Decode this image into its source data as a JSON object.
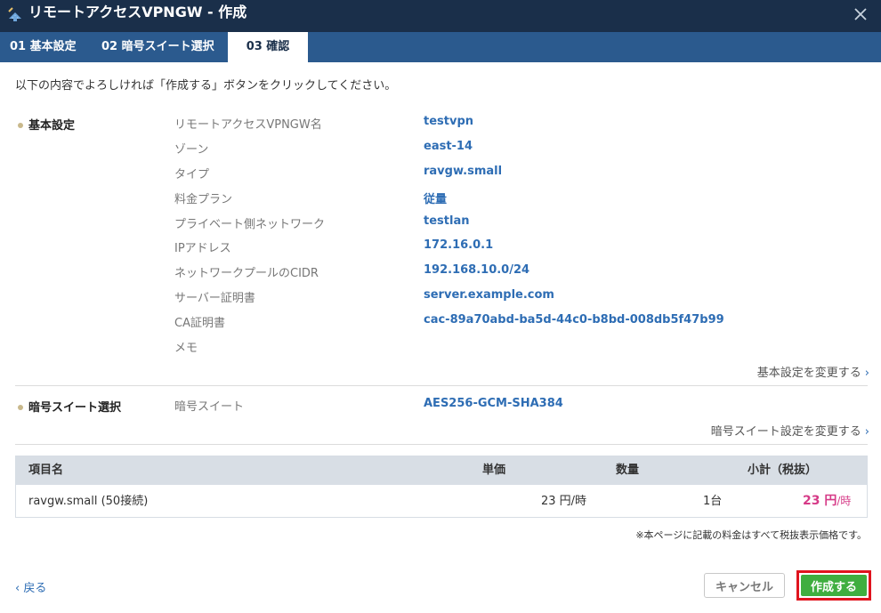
{
  "window": {
    "title": "リモートアクセスVPNGW - 作成",
    "close_symbol": "✕"
  },
  "tabs": [
    {
      "label": "01 基本設定",
      "active": false
    },
    {
      "label": "02 暗号スイート選択",
      "active": false
    },
    {
      "label": "03 確認",
      "active": true
    }
  ],
  "intro": "以下の内容でよろしければ「作成する」ボタンをクリックしてください。",
  "basic": {
    "section_label": "基本設定",
    "rows": [
      {
        "label": "リモートアクセスVPNGW名",
        "value": "testvpn"
      },
      {
        "label": "ゾーン",
        "value": "east-14"
      },
      {
        "label": "タイプ",
        "value": "ravgw.small"
      },
      {
        "label": "料金プラン",
        "value": "従量"
      },
      {
        "label": "プライベート側ネットワーク",
        "value": "testlan"
      },
      {
        "label": "IPアドレス",
        "value": "172.16.0.1"
      },
      {
        "label": "ネットワークプールのCIDR",
        "value": "192.168.10.0/24"
      },
      {
        "label": "サーバー証明書",
        "value": "server.example.com"
      },
      {
        "label": "CA証明書",
        "value": "cac-89a70abd-ba5d-44c0-b8bd-008db5f47b99"
      },
      {
        "label": "メモ",
        "value": ""
      }
    ],
    "change_link": "基本設定を変更する"
  },
  "cipher": {
    "section_label": "暗号スイート選択",
    "rows": [
      {
        "label": "暗号スイート",
        "value": "AES256-GCM-SHA384"
      }
    ],
    "change_link": "暗号スイート設定を変更する"
  },
  "price_table": {
    "headers": {
      "item": "項目名",
      "unit_price": "単価",
      "quantity": "数量",
      "subtotal": "小計（税抜）"
    },
    "row": {
      "item": "ravgw.small (50接続)",
      "unit_price": "23 円/時",
      "quantity": "1台",
      "subtotal_amount": "23 円",
      "subtotal_unit": "/時"
    }
  },
  "note": "※本ページに記載の料金はすべて税抜表示価格です。",
  "footer": {
    "back": "戻る",
    "cancel": "キャンセル",
    "create": "作成する"
  },
  "colors": {
    "titlebar": "#1a2f4a",
    "tabbar": "#2b5a8e",
    "link": "#2e6db4",
    "create_button": "#3fae3f",
    "highlight": "#e0141e",
    "price": "#d63a87"
  }
}
